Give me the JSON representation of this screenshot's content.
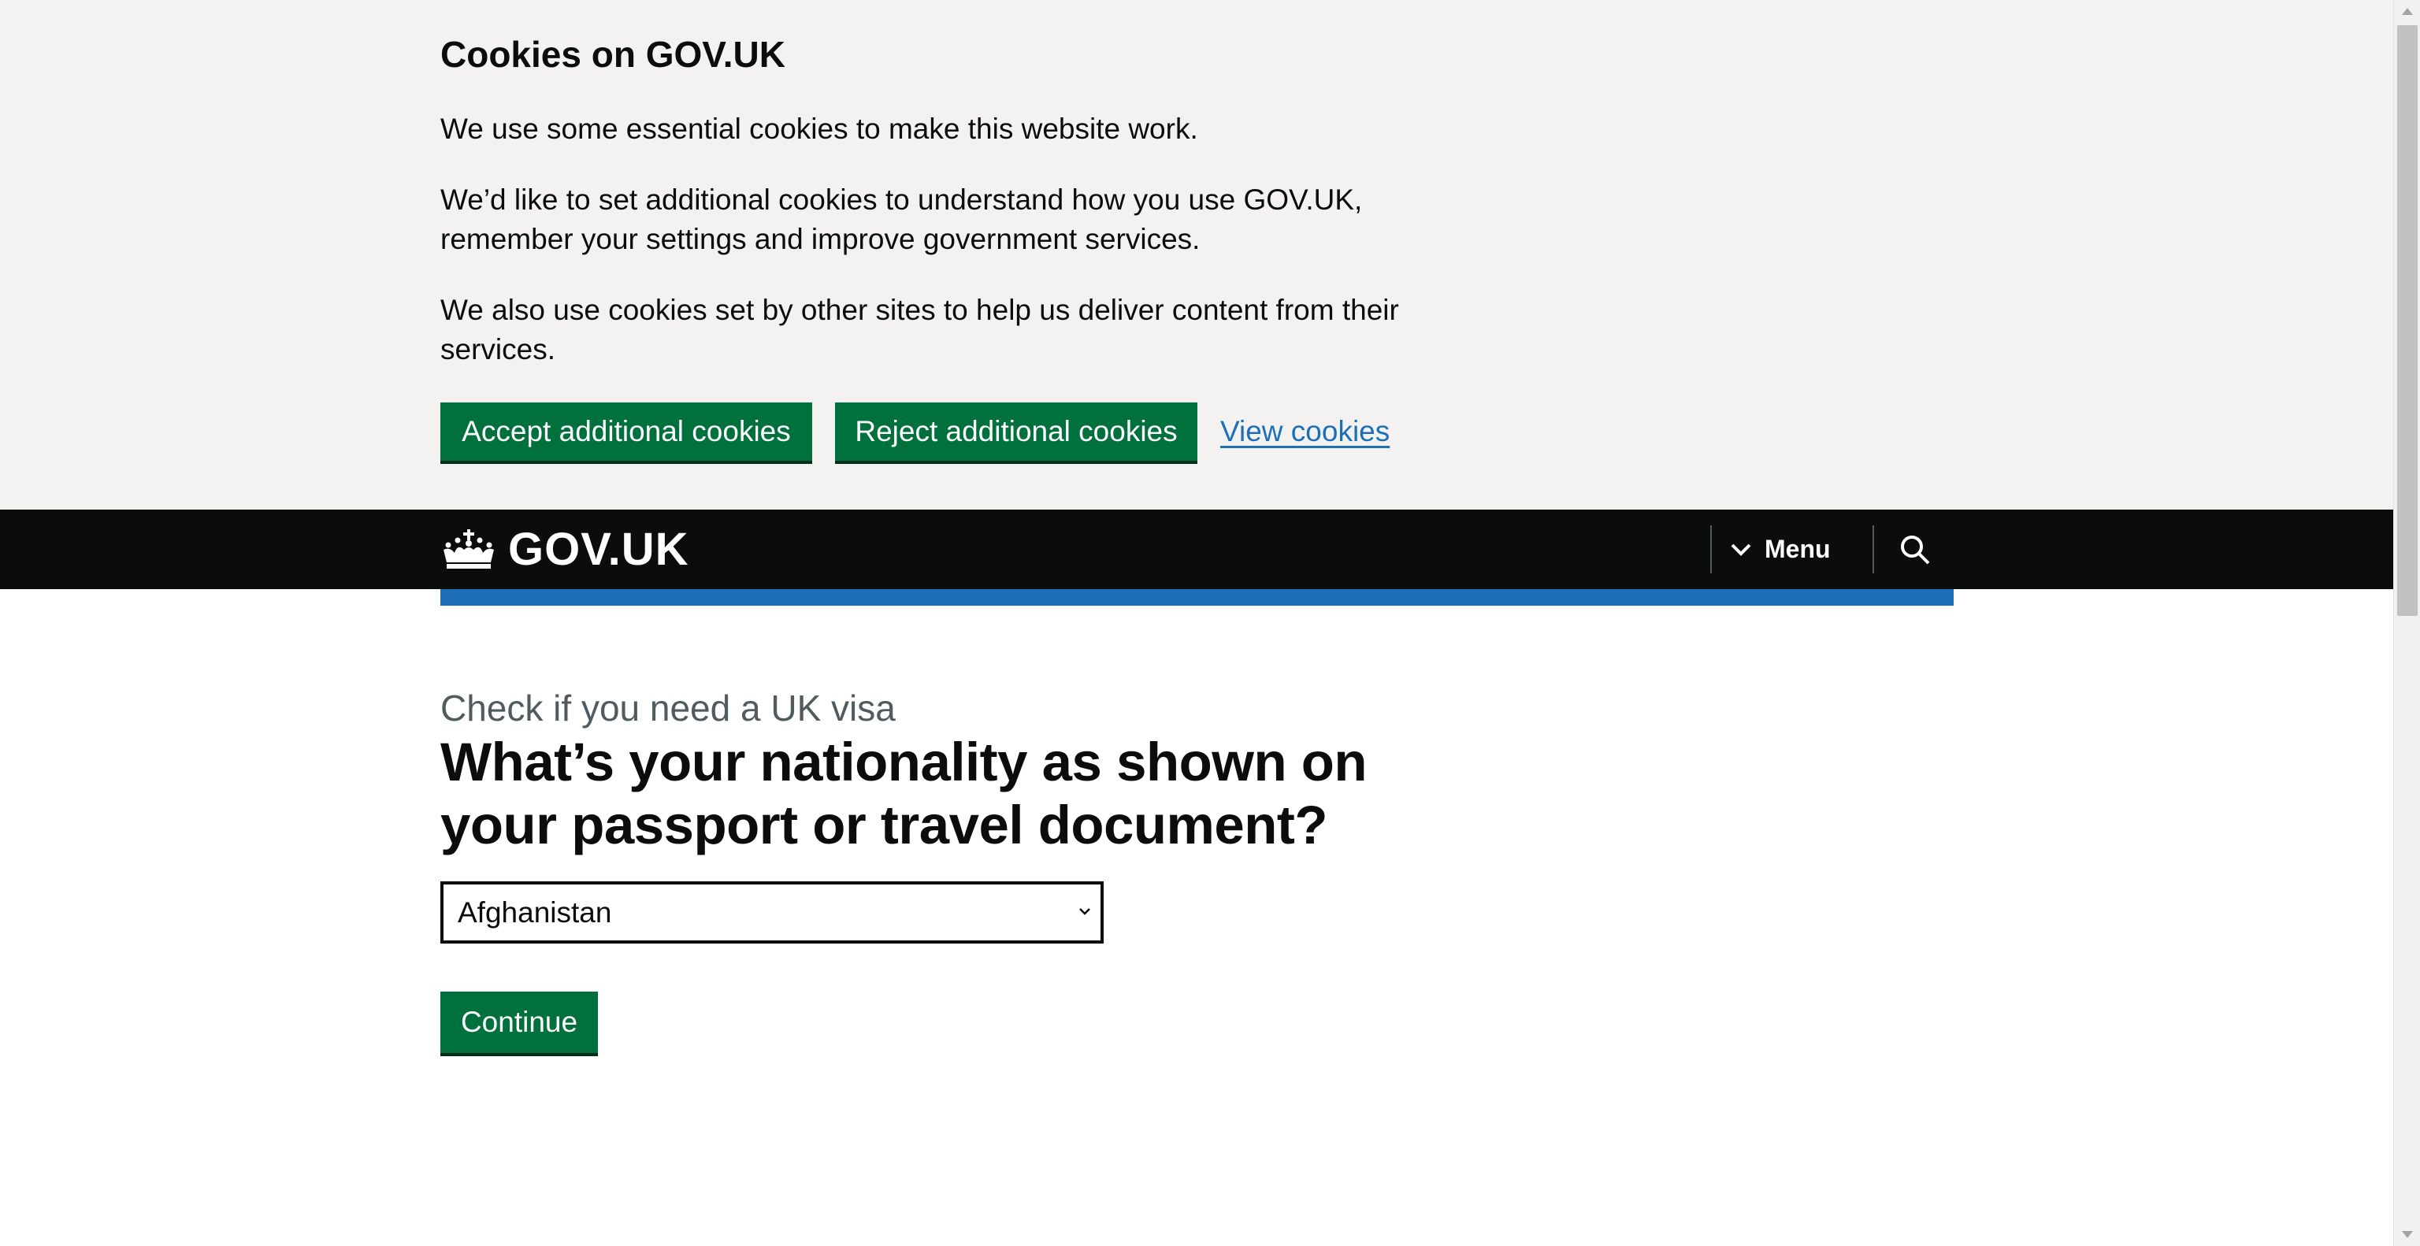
{
  "cookie_banner": {
    "title": "Cookies on GOV.UK",
    "paragraphs": [
      "We use some essential cookies to make this website work.",
      "We’d like to set additional cookies to understand how you use GOV.UK, remember your settings and improve government services.",
      "We also use cookies set by other sites to help us deliver content from their services."
    ],
    "accept_label": "Accept additional cookies",
    "reject_label": "Reject additional cookies",
    "view_label": "View cookies"
  },
  "header": {
    "logo_text": "GOV.UK",
    "logo_icon": "crown-icon",
    "menu_label": "Menu",
    "menu_icon": "chevron-down-icon",
    "search_icon": "search-icon"
  },
  "main": {
    "caption": "Check if you need a UK visa",
    "question": "What’s your nationality as shown on your passport or travel document?",
    "nationality_select": {
      "selected": "Afghanistan"
    },
    "continue_label": "Continue"
  },
  "colors": {
    "banner_bg": "#f3f2f1",
    "header_bg": "#0b0c0c",
    "brand_blue": "#1d70b8",
    "button_green": "#00703c",
    "link_blue": "#1d70b8",
    "caption_grey": "#505a5f"
  }
}
